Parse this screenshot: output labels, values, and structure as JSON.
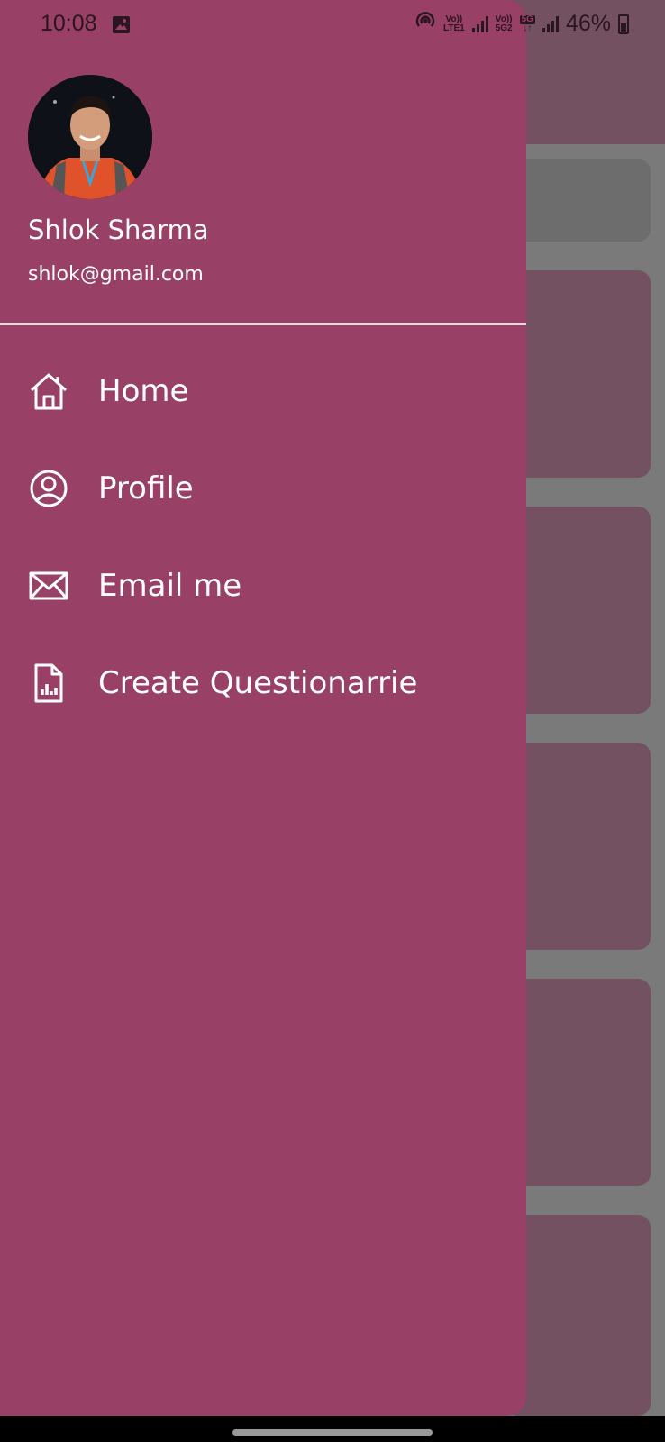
{
  "status_bar": {
    "time": "10:08",
    "sim1_label_top": "Vo))",
    "sim1_label_bottom": "LTE1",
    "sim2_label_top": "Vo))",
    "sim2_label_bottom": "5G2",
    "network_badge": "5G",
    "battery_percent": "46%"
  },
  "drawer": {
    "user": {
      "name": "Shlok Sharma",
      "email": "shlok@gmail.com"
    },
    "menu": [
      {
        "label": "Home",
        "icon": "home-icon"
      },
      {
        "label": "Profile",
        "icon": "account-circle-icon"
      },
      {
        "label": "Email me",
        "icon": "mail-icon"
      },
      {
        "label": "Create Questionarrie",
        "icon": "document-chart-icon"
      }
    ]
  },
  "colors": {
    "drawer_background": "#984066",
    "scrim_background": "#7a7a7a",
    "text": "#ffffff"
  }
}
